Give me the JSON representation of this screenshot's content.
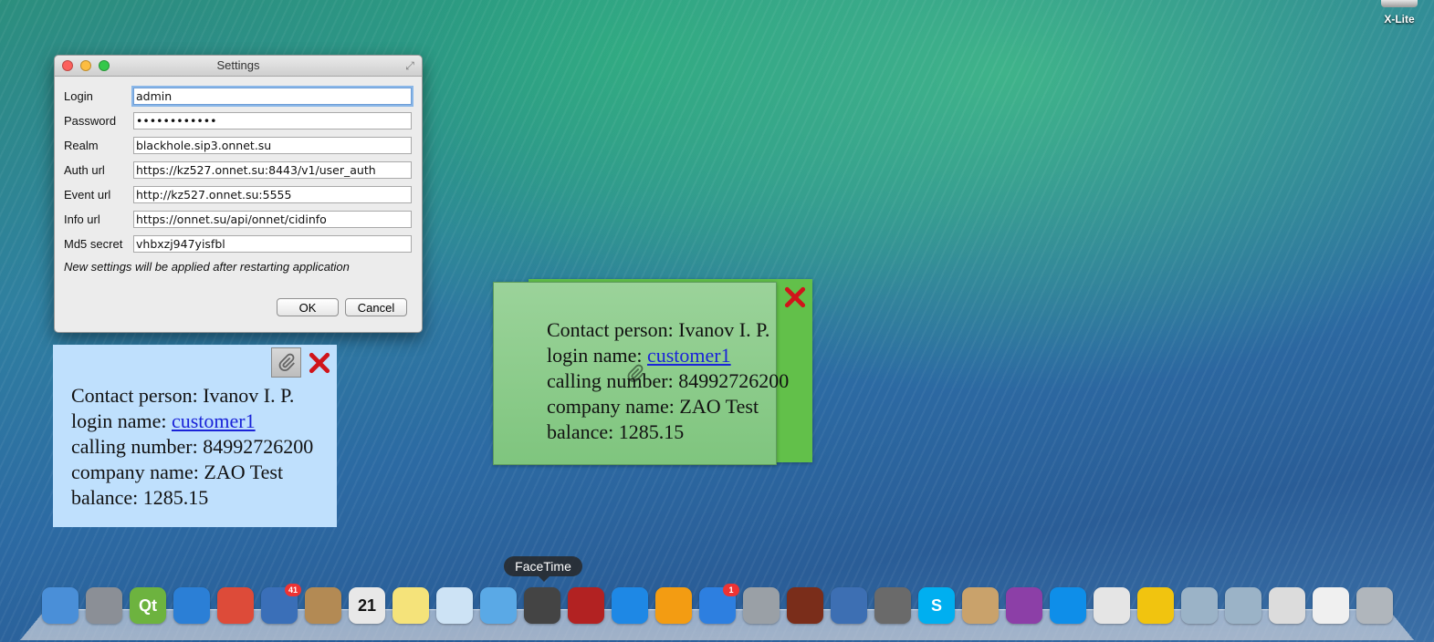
{
  "menubar_app": {
    "label": "X-Lite"
  },
  "settings": {
    "title": "Settings",
    "fields": [
      {
        "label": "Login",
        "value": "admin"
      },
      {
        "label": "Password",
        "value": "••••••••••••"
      },
      {
        "label": "Realm",
        "value": "blackhole.sip3.onnet.su"
      },
      {
        "label": "Auth url",
        "value": "https://kz527.onnet.su:8443/v1/user_auth"
      },
      {
        "label": "Event url",
        "value": "http://kz527.onnet.su:5555"
      },
      {
        "label": "Info url",
        "value": "https://onnet.su/api/onnet/cidinfo"
      },
      {
        "label": "Md5 secret",
        "value": "vhbxzj947yisfbl"
      }
    ],
    "note": "New settings will be applied after restarting application",
    "ok_label": "OK",
    "cancel_label": "Cancel"
  },
  "popup_blue": {
    "contact_label": "Contact person: ",
    "contact_value": "Ivanov I. P.",
    "login_label": "login name: ",
    "login_value": "customer1",
    "calling_label": "calling number: ",
    "calling_value": "84992726200",
    "company_label": "company name: ",
    "company_value": "ZAO Test",
    "balance_label": "balance: ",
    "balance_value": "1285.15",
    "bg_color": "#bfe0fd"
  },
  "popup_green": {
    "contact_label": "Contact person: ",
    "contact_value": "Ivanov I. P.",
    "login_label": "login name: ",
    "login_value": "customer1",
    "calling_label": "calling number: ",
    "calling_value": "84992726200",
    "company_label": "company name: ",
    "company_value": "ZAO Test",
    "balance_label": "balance: ",
    "balance_value": "1285.15",
    "bg_color": "#62c04a"
  },
  "dock": {
    "tooltip": "FaceTime",
    "items": [
      {
        "name": "finder",
        "icon": "finder-icon"
      },
      {
        "name": "launchpad",
        "icon": "rocket-icon"
      },
      {
        "name": "qt",
        "icon": "qt-icon",
        "text": "Qt"
      },
      {
        "name": "safari",
        "icon": "compass-icon"
      },
      {
        "name": "chrome",
        "icon": "chrome-icon"
      },
      {
        "name": "mail",
        "icon": "mail-icon",
        "badge": "41"
      },
      {
        "name": "contacts",
        "icon": "contacts-icon"
      },
      {
        "name": "calendar",
        "icon": "calendar-icon",
        "text": "21"
      },
      {
        "name": "notes",
        "icon": "notes-icon"
      },
      {
        "name": "preview",
        "icon": "preview-icon"
      },
      {
        "name": "messages",
        "icon": "chat-icon"
      },
      {
        "name": "facetime",
        "icon": "camera-icon"
      },
      {
        "name": "photo-booth",
        "icon": "photobooth-icon"
      },
      {
        "name": "itunes",
        "icon": "music-icon"
      },
      {
        "name": "ibooks",
        "icon": "book-icon"
      },
      {
        "name": "app-store",
        "icon": "appstore-icon",
        "badge": "1"
      },
      {
        "name": "system-preferences",
        "icon": "gear-icon"
      },
      {
        "name": "audio-book",
        "icon": "speaker-icon"
      },
      {
        "name": "quicktime",
        "icon": "quicktime-icon"
      },
      {
        "name": "automator",
        "icon": "automator-icon"
      },
      {
        "name": "skype",
        "icon": "skype-icon",
        "text": "S"
      },
      {
        "name": "archive",
        "icon": "box-icon"
      },
      {
        "name": "display",
        "icon": "monitor-icon"
      },
      {
        "name": "teamviewer",
        "icon": "teamviewer-icon"
      },
      {
        "name": "script-editor",
        "icon": "pencil-icon"
      },
      {
        "name": "x-lite",
        "icon": "phone-icon"
      },
      {
        "name": "applications-folder",
        "icon": "folder-icon"
      },
      {
        "name": "downloads-folder",
        "icon": "folder-download-icon"
      },
      {
        "name": "stack-1",
        "icon": "stack-icon"
      },
      {
        "name": "stack-2",
        "icon": "document-stack-icon"
      },
      {
        "name": "trash",
        "icon": "trash-icon"
      }
    ]
  }
}
